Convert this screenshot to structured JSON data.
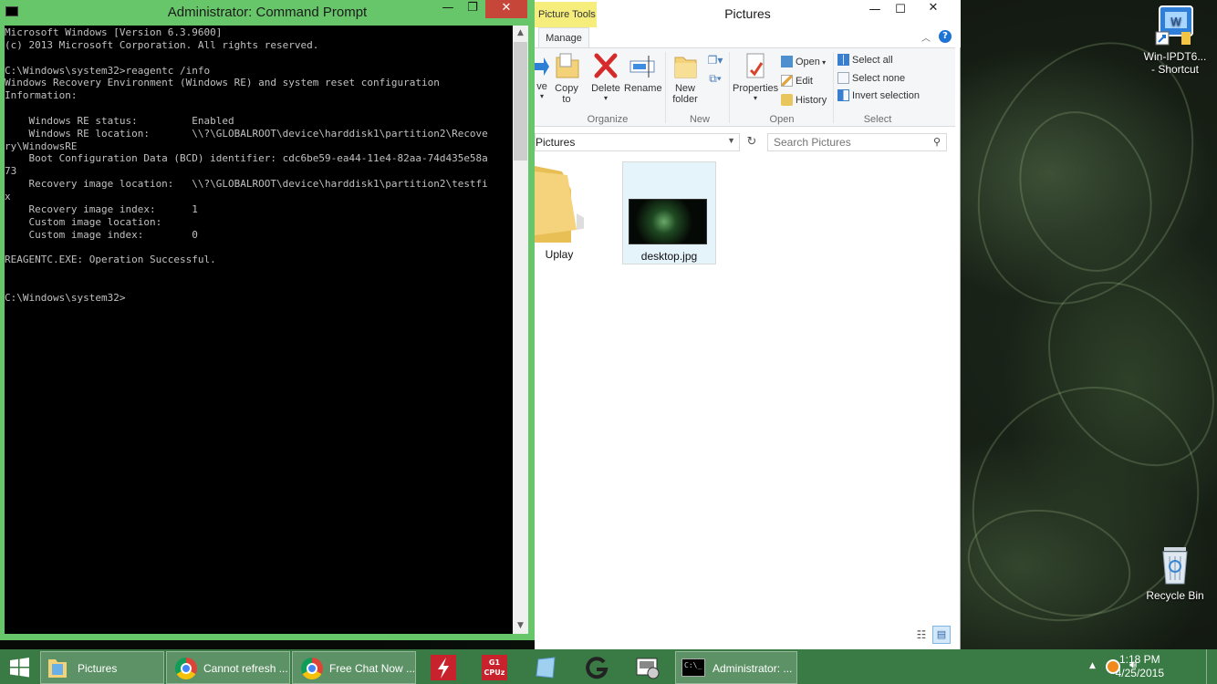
{
  "cmd": {
    "title": "Administrator: Command Prompt",
    "console_text": "Microsoft Windows [Version 6.3.9600]\n(c) 2013 Microsoft Corporation. All rights reserved.\n\nC:\\Windows\\system32>reagentc /info\nWindows Recovery Environment (Windows RE) and system reset configuration\nInformation:\n\n    Windows RE status:         Enabled\n    Windows RE location:       \\\\?\\GLOBALROOT\\device\\harddisk1\\partition2\\Recove\nry\\WindowsRE\n    Boot Configuration Data (BCD) identifier: cdc6be59-ea44-11e4-82aa-74d435e58a\n73\n    Recovery image location:   \\\\?\\GLOBALROOT\\device\\harddisk1\\partition2\\testfi\nx\n    Recovery image index:      1\n    Custom image location:\n    Custom image index:        0\n\nREAGENTC.EXE: Operation Successful.\n\n\nC:\\Windows\\system32>",
    "minimize": "—",
    "maximize": "❐",
    "close": "✕"
  },
  "explorer": {
    "context_tab": "Picture Tools",
    "title": "Pictures",
    "ribbon_tab": "Manage",
    "minimize": "—",
    "maximize": "☐",
    "close": "✕",
    "ribbon": {
      "move_partial": "ve",
      "copy_to_1": "Copy",
      "copy_to_2": "to",
      "delete": "Delete",
      "rename": "Rename",
      "new_folder_1": "New",
      "new_folder_2": "folder",
      "properties": "Properties",
      "open": "Open",
      "edit": "Edit",
      "history": "History",
      "select_all": "Select all",
      "select_none": "Select none",
      "invert_selection": "Invert selection",
      "groups": {
        "organize": "Organize",
        "new": "New",
        "open": "Open",
        "select": "Select"
      }
    },
    "address": "Pictures",
    "search_placeholder": "Search Pictures",
    "files": [
      {
        "name": "Uplay",
        "type": "folder"
      },
      {
        "name": "desktop.jpg",
        "type": "image"
      }
    ]
  },
  "desktop": {
    "icons": [
      {
        "label_1": "Win-IPDT6...",
        "label_2": "- Shortcut",
        "icon": "shortcut-icon"
      },
      {
        "label_1": "Recycle Bin",
        "icon": "recycle-bin-icon"
      }
    ]
  },
  "taskbar": {
    "items": [
      {
        "label": "Pictures",
        "icon": "folder-icon"
      },
      {
        "label": "Cannot refresh ...",
        "icon": "chrome-icon"
      },
      {
        "label": "Free Chat Now ...",
        "icon": "chrome-icon"
      },
      {
        "label": "",
        "icon": "flash-icon"
      },
      {
        "label": "",
        "icon": "cpuz-icon"
      },
      {
        "label": "",
        "icon": "notes-icon"
      },
      {
        "label": "",
        "icon": "logitech-icon"
      },
      {
        "label": "",
        "icon": "tool-icon"
      },
      {
        "label": "Administrator: ...",
        "icon": "cmd-icon"
      }
    ],
    "cpuz_text": "G1\nCPUz",
    "time": "1:18 PM",
    "date": "4/25/2015"
  },
  "colors": {
    "accent": "#68c66a",
    "taskbar": "#3a7a45",
    "close_red": "#c7463a",
    "context_yellow": "#f5ed7c",
    "selection_blue": "#e5f3fb"
  }
}
